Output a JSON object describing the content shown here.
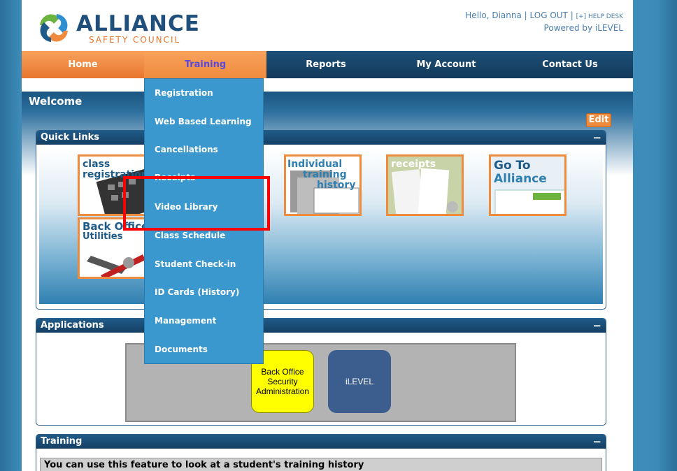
{
  "header": {
    "logo_name": "ALLIANCE",
    "logo_tagline": "SAFETY COUNCIL",
    "greeting": "Hello, Dianna",
    "logout": "LOG OUT",
    "help_desk": "[+] HELP DESK",
    "powered_by": "Powered by iLEVEL"
  },
  "nav": {
    "items": [
      {
        "label": "Home"
      },
      {
        "label": "Training"
      },
      {
        "label": "Reports"
      },
      {
        "label": "My Account"
      },
      {
        "label": "Contact Us"
      }
    ]
  },
  "welcome": {
    "title": "Welcome",
    "edit_label": "Edit"
  },
  "quick_links": {
    "title": "Quick Links",
    "minimize": "−",
    "tiles": [
      {
        "label_1": "class",
        "label_2": "registration"
      },
      {
        "label_1": "Individual",
        "label_2": "training",
        "label_3": "history"
      },
      {
        "label_1": "receipts"
      },
      {
        "label_1": "Go To",
        "label_2": "Alliance"
      },
      {
        "label_1": "Back Office",
        "label_2": "Utilities"
      }
    ]
  },
  "applications": {
    "title": "Applications",
    "minimize": "−",
    "apps": [
      {
        "label": "Back Office Security Administration"
      },
      {
        "label": "iLEVEL"
      }
    ]
  },
  "training": {
    "title": "Training",
    "minimize": "−",
    "note": "You can use this feature to look at a student's training history"
  },
  "training_menu": {
    "items": [
      {
        "label": "Registration"
      },
      {
        "label": "Web Based Learning"
      },
      {
        "label": "Cancellations"
      },
      {
        "label": "Receipts"
      },
      {
        "label": "Video Library"
      },
      {
        "label": "Class Schedule"
      },
      {
        "label": "Student Check-in"
      },
      {
        "label": "ID Cards (History)"
      },
      {
        "label": "Management"
      },
      {
        "label": "Documents"
      }
    ]
  },
  "colors": {
    "nav_bg": "#1d4f78",
    "nav_active": "#ef8b3d",
    "dropdown_bg": "#3a98cf",
    "highlight": "#ff0000"
  }
}
